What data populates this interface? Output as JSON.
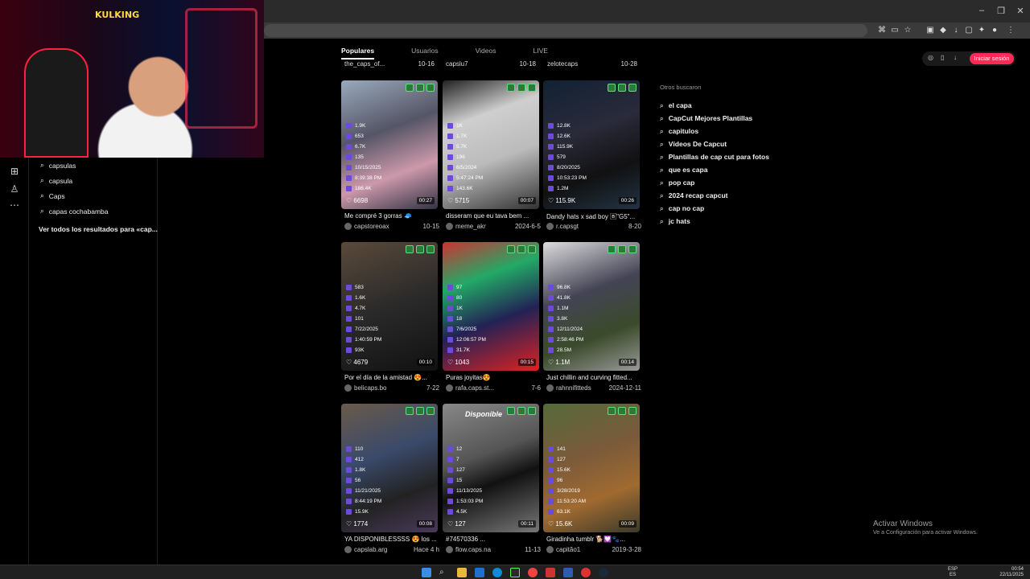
{
  "browser": {
    "close_symbol": "✕",
    "maximize_symbol": "❐",
    "minimize_symbol": "–"
  },
  "webcam": {
    "overlay_text": "KULKING"
  },
  "search_panel": {
    "suggestions": [
      "capsulas",
      "capsula",
      "Caps",
      "capas cochabamba"
    ],
    "see_all": "Ver todos los resultados para «cap..."
  },
  "tabs": [
    "Populares",
    "Usuarios",
    "Videos",
    "LIVE"
  ],
  "top_partial_row": [
    {
      "user": "the_caps_of...",
      "date": "10-16"
    },
    {
      "user": "capslu7",
      "date": "10-18"
    },
    {
      "user": "zelotecaps",
      "date": "10-28"
    }
  ],
  "videos": [
    {
      "stats": [
        "1.9K",
        "653",
        "6.7K",
        "135",
        "10/15/2025",
        "8:39:38 PM",
        "186.4K"
      ],
      "likes": "6698",
      "duration": "00:27",
      "caption": "Me compré 3 gorras 🧢",
      "user": "capstoreoax",
      "date": "10-15"
    },
    {
      "stats": [
        "1K",
        "1.7K",
        "5.7K",
        "196",
        "6/5/2024",
        "5:47:24 PM",
        "143.6K"
      ],
      "likes": "5715",
      "duration": "00:07",
      "caption": "disseram que eu tava bem ...",
      "user": "meme_akr",
      "date": "2024-6-5"
    },
    {
      "stats": [
        "12.8K",
        "12.6K",
        "115.9K",
        "579",
        "8/20/2025",
        "10:53:23 PM",
        "1.2M"
      ],
      "likes": "115.9K",
      "duration": "00:26",
      "caption": "Dandy hats x sad boy 🄱\"G5\"...",
      "user": "r.capsgt",
      "date": "8-20"
    },
    {
      "stats": [
        "583",
        "1.6K",
        "4.7K",
        "101",
        "7/22/2025",
        "1:40:59 PM",
        "93K"
      ],
      "likes": "4679",
      "duration": "00:10",
      "caption": "Por el día de la amistad 😍...",
      "user": "belicaps.bo",
      "date": "7-22"
    },
    {
      "stats": [
        "97",
        "80",
        "1K",
        "18",
        "7/6/2025",
        "12:06:57 PM",
        "31.7K"
      ],
      "likes": "1043",
      "duration": "00:15",
      "caption": "Puras joyitas😍",
      "user": "rafa.caps.st...",
      "date": "7-6"
    },
    {
      "stats": [
        "96.8K",
        "41.8K",
        "1.1M",
        "3.8K",
        "12/11/2024",
        "2:58:46 PM",
        "28.5M"
      ],
      "likes": "1.1M",
      "duration": "00:14",
      "caption": "Just chillin and curving fitted...",
      "user": "rahnnifitteds",
      "date": "2024-12-11"
    },
    {
      "stats": [
        "110",
        "412",
        "1.8K",
        "56",
        "11/21/2025",
        "8:44:19 PM",
        "15.9K"
      ],
      "likes": "1774",
      "duration": "00:08",
      "caption": "YA DISPONIBLESSSS 😍 los ...",
      "user": "capslab.arg",
      "date": "Hace 4 h"
    },
    {
      "stats": [
        "12",
        "7",
        "127",
        "15",
        "11/13/2025",
        "1:53:03 PM",
        "4.5K"
      ],
      "likes": "127",
      "duration": "00:11",
      "caption": "#74570336 ...",
      "user": "flow.caps.na",
      "date": "11-13"
    },
    {
      "stats": [
        "141",
        "127",
        "15.6K",
        "96",
        "3/28/2019",
        "11:53:20 AM",
        "63.1K"
      ],
      "likes": "15.6K",
      "duration": "00:09",
      "caption": "Giradinha tumblr 🐕💟🐾...",
      "user": "capitão1",
      "date": "2019-3-28"
    }
  ],
  "thumb_text": [
    "Disponible"
  ],
  "right_panel": {
    "login_label": "Iniciar sesión",
    "others_title": "Otros buscaron",
    "others": [
      "el capa",
      "CapCut Mejores Plantillas",
      "capitulos",
      "Vídeos De Capcut",
      "Plantillas de cap cut para fotos",
      "que es capa",
      "pop cap",
      "2024 recap capcut",
      "cap no cap",
      "jc hats"
    ]
  },
  "watermark": {
    "line1": "Activar Windows",
    "line2": "Ve a Configuración para activar Windows."
  },
  "taskbar": {
    "lang1": "ESP",
    "lang2": "ES",
    "time": "00:54",
    "date": "22/11/2025"
  },
  "colors": {
    "accent": "#fe2c55",
    "stat_icon": "#6b4bd8"
  }
}
